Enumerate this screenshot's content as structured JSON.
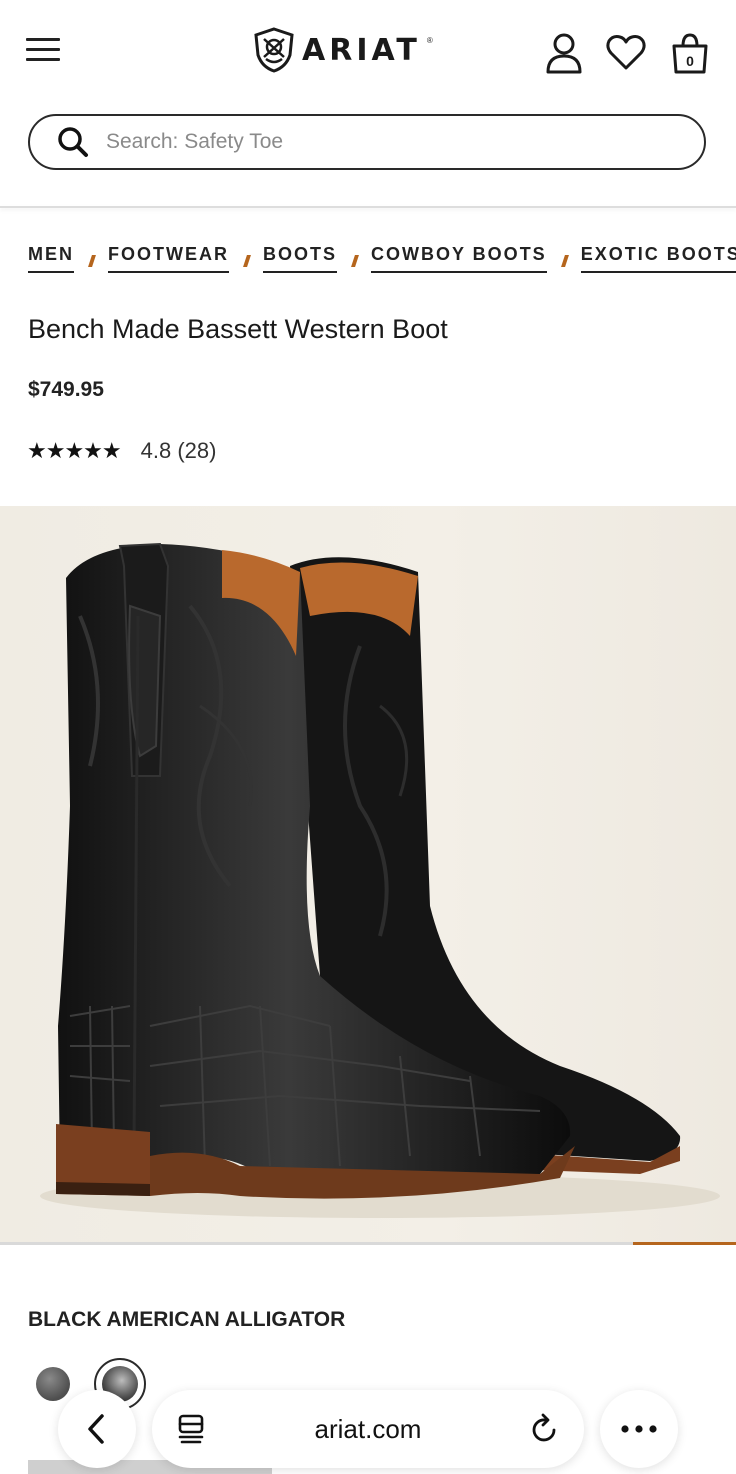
{
  "header": {
    "brand": "ARIAT",
    "brand_mark": "®",
    "cart_count": "0"
  },
  "search": {
    "placeholder": "Search: Safety Toe",
    "value": ""
  },
  "breadcrumb": [
    "MEN",
    "FOOTWEAR",
    "BOOTS",
    "COWBOY BOOTS",
    "EXOTIC BOOTS"
  ],
  "product": {
    "title": "Bench Made Bassett Western Boot",
    "price": "$749.95",
    "stars": "★★★★★",
    "rating": "4.8 (28)",
    "color_name": "BLACK AMERICAN ALLIGATOR",
    "gallery_progress": 0.14
  },
  "browser": {
    "url": "ariat.com"
  },
  "colors": {
    "accent": "#b5651d",
    "text": "#1a1a1a"
  }
}
